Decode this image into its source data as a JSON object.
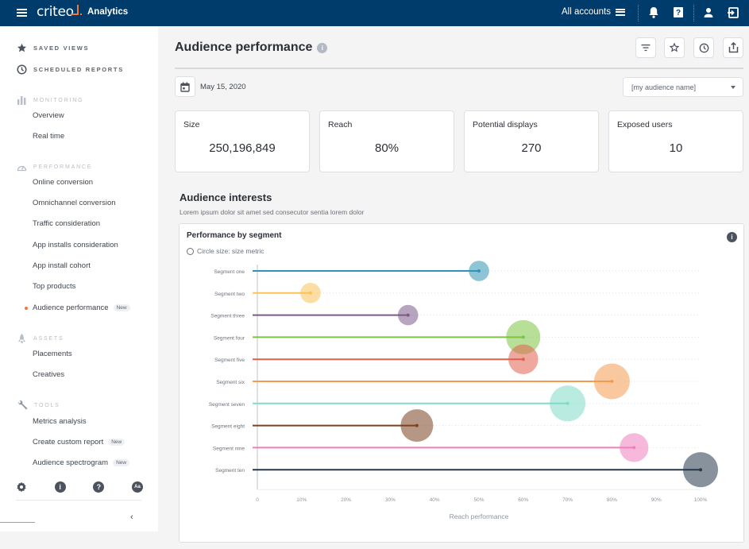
{
  "topbar": {
    "brand": "criteo",
    "app_name": "Analytics",
    "accounts_label": "All accounts",
    "icons": [
      "menu-icon",
      "list-icon",
      "bell-icon",
      "help-icon",
      "user-icon",
      "logout-icon"
    ]
  },
  "sidebar": {
    "top_items": [
      {
        "label": "SAVED VIEWS",
        "icon": "star-icon"
      },
      {
        "label": "SCHEDULED REPORTS",
        "icon": "clock-icon"
      }
    ],
    "sections": [
      {
        "label": "MONITORING",
        "icon": "bar-chart-icon",
        "items": [
          {
            "label": "Overview"
          },
          {
            "label": "Real time"
          }
        ]
      },
      {
        "label": "PERFORMANCE",
        "icon": "gauge-icon",
        "items": [
          {
            "label": "Online conversion"
          },
          {
            "label": "Omnichannel conversion"
          },
          {
            "label": "Traffic consideration"
          },
          {
            "label": "App installs consideration"
          },
          {
            "label": "App install cohort"
          },
          {
            "label": "Top products"
          },
          {
            "label": "Audience performance",
            "badge": "New",
            "active": true
          }
        ]
      },
      {
        "label": "ASSETS",
        "icon": "rocket-icon",
        "items": [
          {
            "label": "Placements"
          },
          {
            "label": "Creatives"
          }
        ]
      },
      {
        "label": "TOOLS",
        "icon": "wrench-icon",
        "items": [
          {
            "label": "Metrics analysis"
          },
          {
            "label": "Create custom report",
            "badge": "New"
          },
          {
            "label": "Audience spectrogram",
            "badge": "New"
          }
        ]
      }
    ],
    "bottom_icons": [
      {
        "name": "settings-icon",
        "glyph": "⚙"
      },
      {
        "name": "info-icon",
        "glyph": "i"
      },
      {
        "name": "help-icon",
        "glyph": "?"
      },
      {
        "name": "font-size-icon",
        "glyph": "Aa"
      }
    ],
    "collapse_glyph": "‹"
  },
  "page": {
    "title": "Audience performance",
    "title_info_glyph": "i",
    "header_buttons": [
      "filter-icon",
      "star-icon",
      "clock-icon",
      "share-icon"
    ],
    "date": "May 15, 2020",
    "audience_select": {
      "value": "[my audience name]"
    },
    "kpis": [
      {
        "label": "Size",
        "value": "250,196,849"
      },
      {
        "label": "Reach",
        "value": "80%"
      },
      {
        "label": "Potential displays",
        "value": "270"
      },
      {
        "label": "Exposed users",
        "value": "10"
      }
    ],
    "section_title": "Audience interests",
    "section_subtitle": "Lorem ipsum dolor sit amet sed consecutor sentia lorem dolor",
    "chart_card": {
      "title": "Performance by segment",
      "legend": "Circle size: size metric",
      "info_glyph": "i"
    }
  },
  "chart_data": {
    "type": "scatter",
    "subtype": "lollipop-bubble",
    "title": "Performance by segment",
    "legend": "Circle size: size metric",
    "xlabel": "Reach performance",
    "ylabel": "",
    "xlim": [
      0,
      100
    ],
    "x_ticks": [
      "0",
      "10%",
      "20%",
      "30%",
      "40%",
      "50%",
      "60%",
      "70%",
      "80%",
      "90%",
      "100%"
    ],
    "grid": "dotted horizontal per segment",
    "categories": [
      "Segment one",
      "Segment two",
      "Segment three",
      "Segment four",
      "Segment five",
      "Segment six",
      "Segment seven",
      "Segment eight",
      "Segment nine",
      "Segment ten"
    ],
    "series": [
      {
        "name": "Reach performance (%)",
        "values": [
          50,
          12,
          34,
          60,
          60,
          80,
          70,
          36,
          85,
          100
        ]
      },
      {
        "name": "Size metric (relative)",
        "values": [
          1,
          1,
          1,
          7,
          4.5,
          8,
          8,
          6,
          4,
          7.5
        ]
      }
    ],
    "colors": [
      "#2f94b5",
      "#f9c35a",
      "#7c5a88",
      "#7dc443",
      "#e0604f",
      "#f59a4e",
      "#80dbc9",
      "#7a4220",
      "#ee7fbf",
      "#24384d"
    ]
  }
}
